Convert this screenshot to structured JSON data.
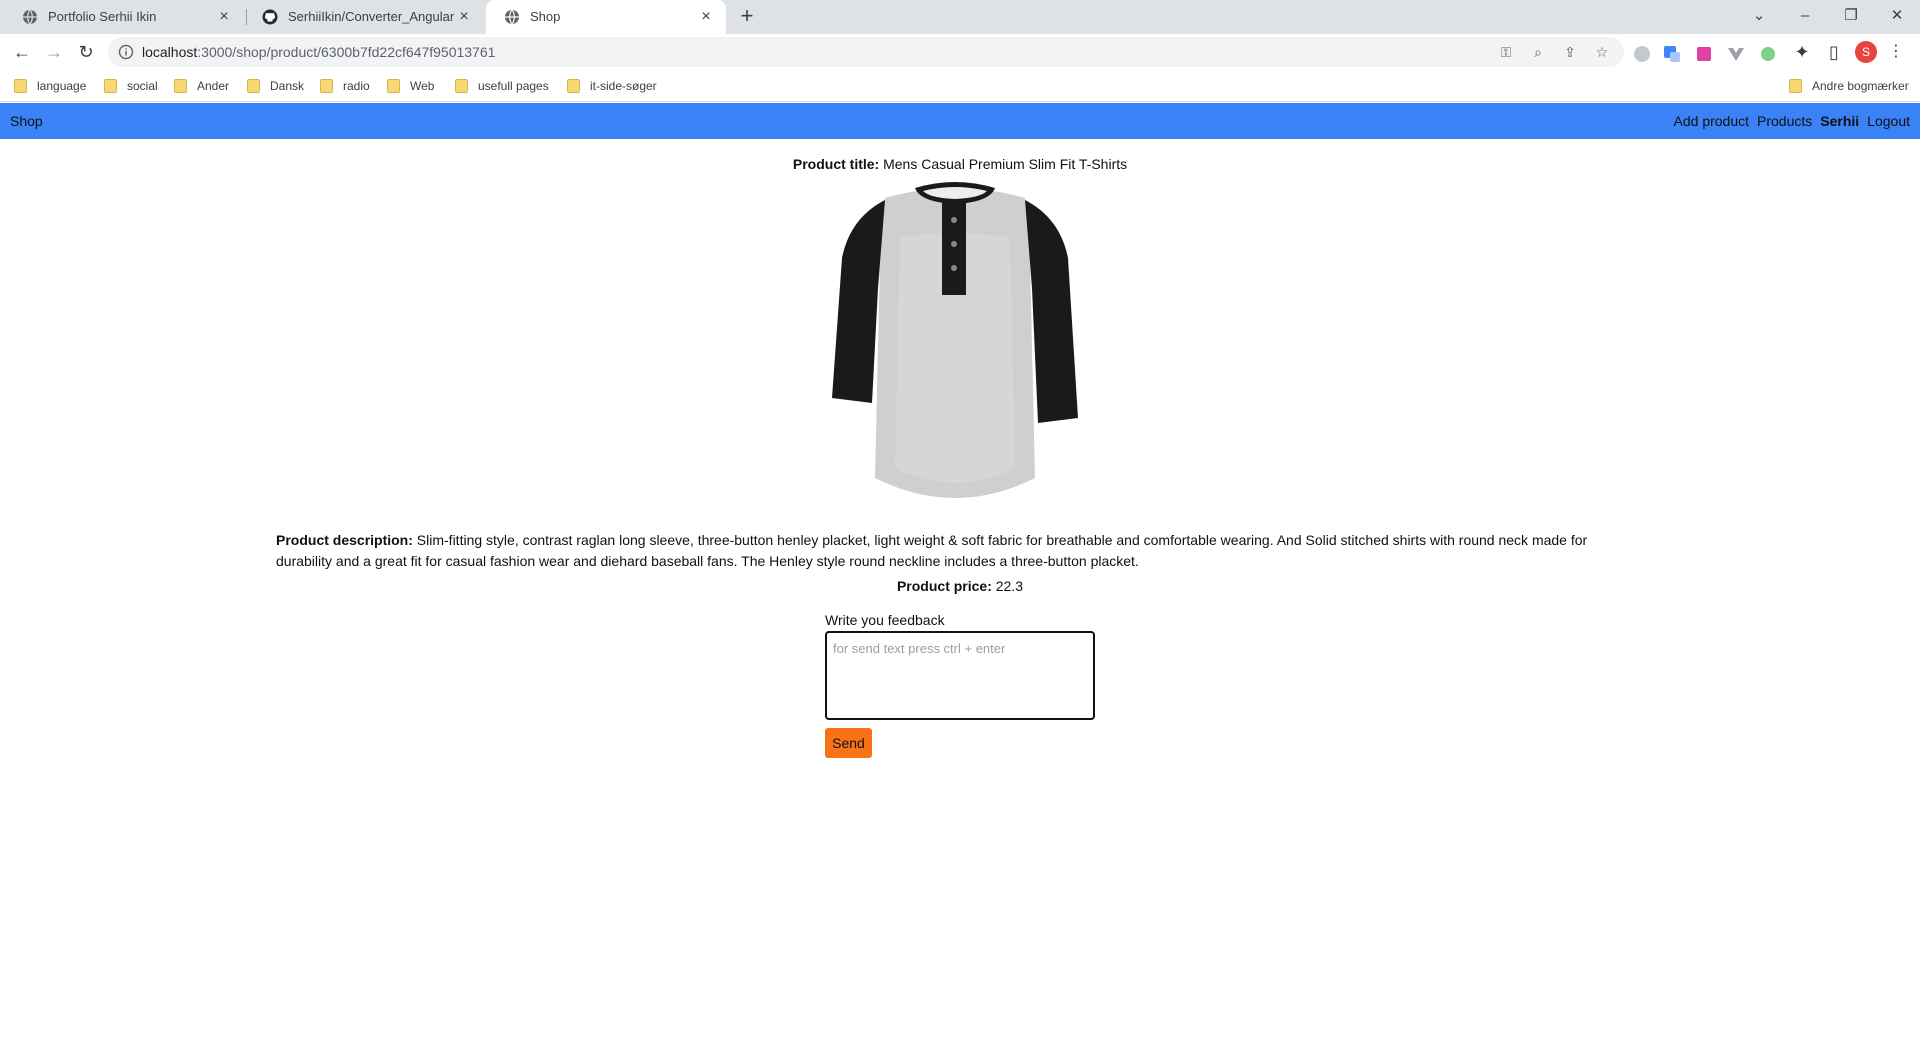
{
  "browser": {
    "tabs": [
      {
        "title": "Portfolio Serhii Ikin",
        "icon": "globe-icon"
      },
      {
        "title": "SerhiiIkin/Converter_Angular",
        "icon": "github-icon"
      },
      {
        "title": "Shop",
        "icon": "globe-icon",
        "active": true
      }
    ],
    "url_host": "localhost",
    "url_rest": ":3000/shop/product/6300b7fd22cf647f95013761",
    "bookmarks": [
      "language",
      "social",
      "Ander",
      "Dansk",
      "radio",
      "Web",
      "usefull pages",
      "it-side-søger"
    ],
    "other_bookmarks": "Andre bogmærker",
    "profile_initial": "S"
  },
  "navbar": {
    "brand": "Shop",
    "add_product": "Add product",
    "products": "Products",
    "user": "Serhii",
    "logout": "Logout",
    "background": "#3b82f6"
  },
  "product": {
    "title_label": "Product title:",
    "title": "Mens Casual Premium Slim Fit T-Shirts",
    "description_label": "Product description:",
    "description": "Slim-fitting style, contrast raglan long sleeve, three-button henley placket, light weight & soft fabric for breathable and comfortable wearing. And Solid stitched shirts with round neck made for durability and a great fit for casual fashion wear and diehard baseball fans. The Henley style round neckline includes a three-button placket.",
    "price_label": "Product price:",
    "price": "22.3"
  },
  "feedback": {
    "label": "Write you feedback",
    "placeholder": "for send text press ctrl + enter",
    "send_label": "Send",
    "send_color": "#f97316"
  }
}
